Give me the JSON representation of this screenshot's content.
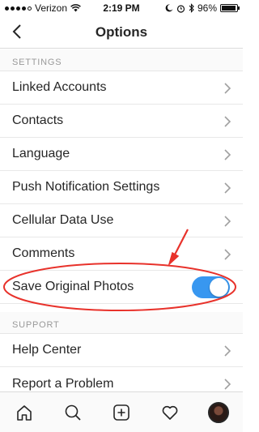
{
  "status_bar": {
    "carrier": "Verizon",
    "time": "2:19 PM",
    "battery": "96%",
    "battery_level": 0.96
  },
  "header": {
    "title": "Options"
  },
  "sections": {
    "settings": {
      "label": "SETTINGS"
    },
    "support": {
      "label": "SUPPORT"
    }
  },
  "settings_items": [
    {
      "label": "Linked Accounts"
    },
    {
      "label": "Contacts"
    },
    {
      "label": "Language"
    },
    {
      "label": "Push Notification Settings"
    },
    {
      "label": "Cellular Data Use"
    },
    {
      "label": "Comments"
    }
  ],
  "save_original_photos": {
    "label": "Save Original Photos",
    "enabled": true
  },
  "support_items": [
    {
      "label": "Help Center"
    },
    {
      "label": "Report a Problem"
    }
  ],
  "tab_bar": {
    "icons": [
      "home-icon",
      "search-icon",
      "add-post-icon",
      "heart-icon",
      "profile-avatar"
    ]
  },
  "colors": {
    "toggle_on": "#3897f0",
    "annotation": "#e8322b"
  }
}
